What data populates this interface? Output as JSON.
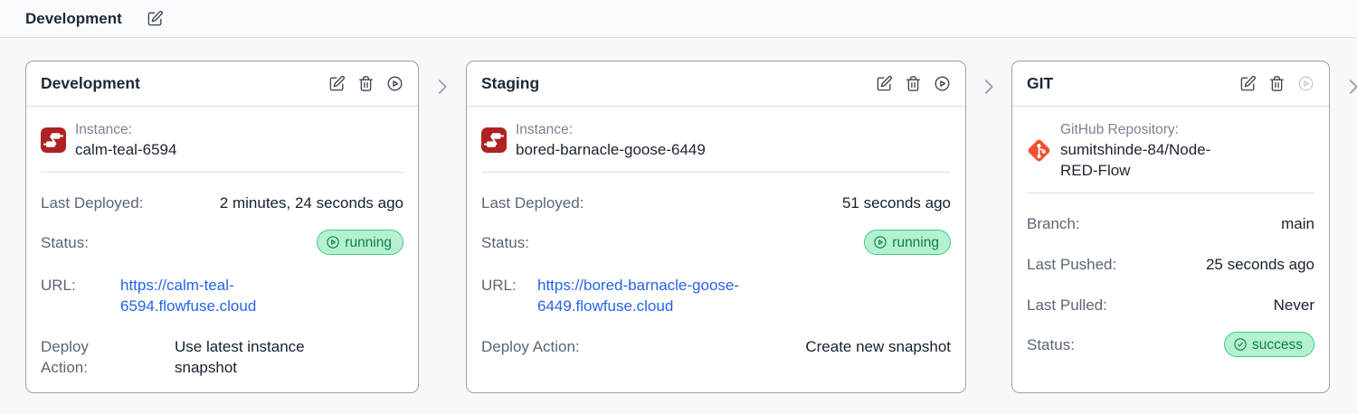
{
  "topbar": {
    "title": "Development"
  },
  "colors": {
    "link": "#2563EB",
    "badge_bg": "#B4F1CE",
    "badge_border": "#43C988",
    "badge_text": "#0E7D4F",
    "nodered": "#AE2222",
    "git": "#F05133"
  },
  "icons": {
    "topbar": "edit-icon",
    "card_actions": [
      "edit-icon",
      "trash-icon",
      "play-circle-icon"
    ],
    "separator": "chevron-right-icon",
    "running_badge": "play-circle-icon",
    "success_badge": "check-circle-icon",
    "instance": "node-red-icon",
    "repository": "git-icon"
  },
  "stages": {
    "development": {
      "title": "Development",
      "instance_label": "Instance:",
      "instance_name": "calm-teal-6594",
      "last_deployed_label": "Last Deployed:",
      "last_deployed": "2 minutes, 24 seconds ago",
      "status_label": "Status:",
      "status": "running",
      "url_label": "URL:",
      "url": "https://calm-teal-6594.flowfuse.cloud",
      "deploy_action_label": "Deploy Action:",
      "deploy_action": "Use latest instance snapshot"
    },
    "staging": {
      "title": "Staging",
      "instance_label": "Instance:",
      "instance_name": "bored-barnacle-goose-6449",
      "last_deployed_label": "Last Deployed:",
      "last_deployed": "51 seconds ago",
      "status_label": "Status:",
      "status": "running",
      "url_label": "URL:",
      "url": "https://bored-barnacle-goose-6449.flowfuse.cloud",
      "deploy_action_label": "Deploy Action:",
      "deploy_action": "Create new snapshot"
    },
    "git": {
      "title": "GIT",
      "repo_label": "GitHub Repository:",
      "repo_name": "sumitshinde-84/Node-RED-Flow",
      "branch_label": "Branch:",
      "branch": "main",
      "last_pushed_label": "Last Pushed:",
      "last_pushed": "25 seconds ago",
      "last_pulled_label": "Last Pulled:",
      "last_pulled": "Never",
      "status_label": "Status:",
      "status": "success"
    }
  }
}
